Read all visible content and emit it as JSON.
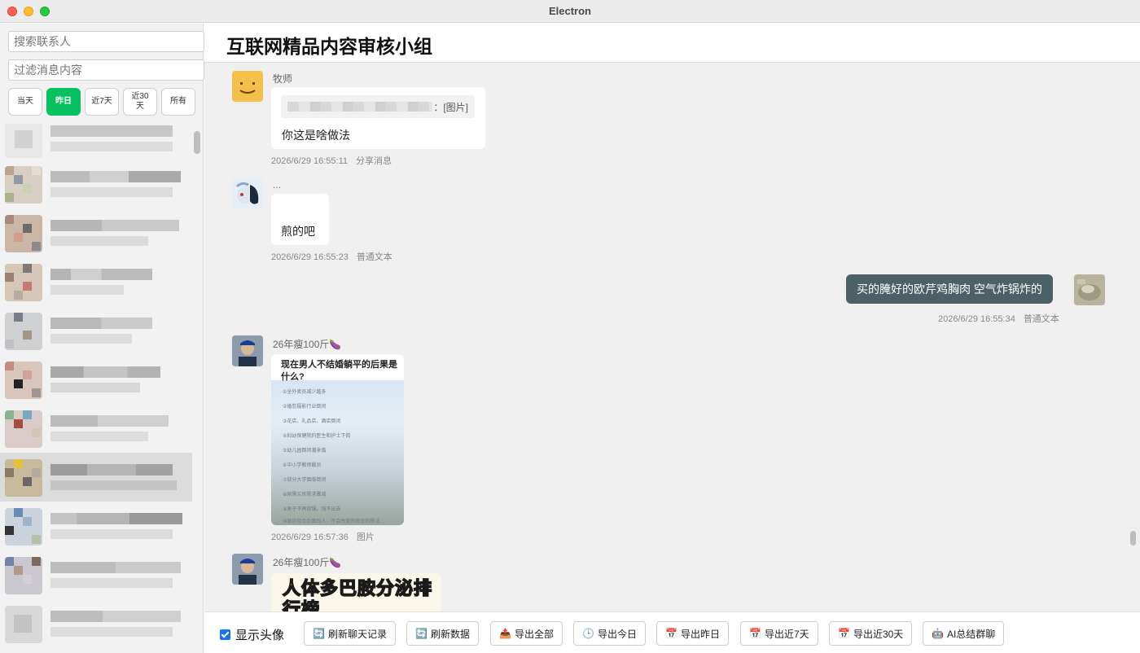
{
  "window": {
    "title": "Electron"
  },
  "sidebar": {
    "search_placeholder": "搜索联系人",
    "filter_placeholder": "过滤消息内容",
    "filters": [
      {
        "label": "当天",
        "active": false
      },
      {
        "label": "昨日",
        "active": true
      },
      {
        "label": "近7天",
        "active": false
      },
      {
        "label": "近30天",
        "active": false
      },
      {
        "label": "所有",
        "active": false
      }
    ]
  },
  "chat": {
    "title": "互联网精品内容审核小组",
    "messages": [
      {
        "sender": "牧师",
        "quote_tag": "：[图片]",
        "text": "你这是啥做法",
        "time": "2026/6/29 16:55:11",
        "type": "分享消息"
      },
      {
        "sender": "...",
        "text": "煎的吧",
        "time": "2026/6/29 16:55:23",
        "type": "普通文本"
      },
      {
        "sender": "",
        "text": "买的腌好的欧芹鸡胸肉 空气炸锅炸的",
        "time": "2026/6/29 16:55:34",
        "type": "普通文本",
        "outgoing": true
      },
      {
        "sender": "26年瘦100斤🍆",
        "image_title": "现在男人不结婚躺平的后果是什么?",
        "image_lines": [
          "①全外卖员减少越多",
          "②婚恋摄影行业倒闭",
          "③花店、礼品店、酒店倒闭",
          "④妇幼保健院的医生和护士下岗",
          "⑤幼儿园倒闭潮来临",
          "⑥中小学教师裁员",
          "⑦部分大学面临倒闭",
          "⑧刚需买房需求骤减",
          "⑨男子不再背锅，钱不出去",
          "⑩被迫背负负面的人，不会改变的观念的想法"
        ],
        "time": "2026/6/29 16:57:36",
        "type": "图片"
      },
      {
        "sender": "26年瘦100斤🍆",
        "image_text": "人体多巴胺分泌排行榜"
      }
    ]
  },
  "toolbar": {
    "show_avatar_label": "显示头像",
    "show_avatar_checked": true,
    "buttons": [
      {
        "label": "刷新聊天记录",
        "icon": "refresh-icon"
      },
      {
        "label": "刷新数据",
        "icon": "refresh-icon"
      },
      {
        "label": "导出全部",
        "icon": "export-tray-icon"
      },
      {
        "label": "导出今日",
        "icon": "clock-icon"
      },
      {
        "label": "导出昨日",
        "icon": "calendar-icon"
      },
      {
        "label": "导出近7天",
        "icon": "calendar-icon"
      },
      {
        "label": "导出近30天",
        "icon": "calendar-icon"
      },
      {
        "label": "AI总结群聊",
        "icon": "robot-icon"
      }
    ]
  }
}
